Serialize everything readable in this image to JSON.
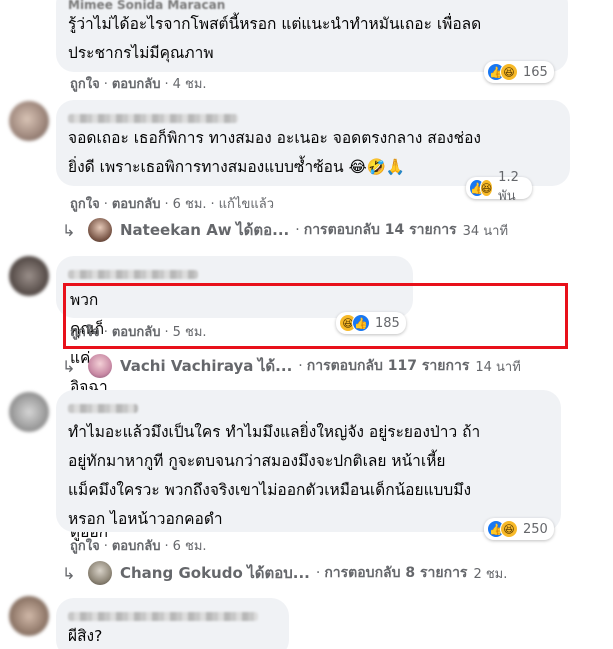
{
  "comments": [
    {
      "author": "Mimee Sonida Maracan",
      "text": "รู้ว่าไม่ได้อะไรจากโพสต์นี้หรอก แต่แนะนำทำหมันเถอะ เพื่อลด\nประชากรไม่มีคุณภาพ",
      "like_label": "ถูกใจ",
      "reply_label": "ตอบกลับ",
      "time": "4 ชม.",
      "reaction_count": "165"
    },
    {
      "author": "",
      "text": "จอดเถอะ เธอก็พิการ ทางสมอง อะเนอะ จอดตรงกลาง สองช่อง\nยิ่งดี เพราะเธอพิการทางสมองแบบซ้ำซ้อน 😂🤣🙏",
      "like_label": "ถูกใจ",
      "reply_label": "ตอบกลับ",
      "time": "6 ชม.",
      "edited_label": "แก้ไขแล้ว",
      "reaction_count": "1.2 พัน",
      "reply_summary": {
        "name": "Nateekan Aw",
        "action": "ได้ตอ...",
        "count_text": "การตอบกลับ 14 รายการ",
        "time": "34 นาที"
      }
    },
    {
      "author": "",
      "text": "พวกคุณก็แค่อิจฉาคนขับ Benz แหละ ดูออก",
      "like_label": "ถูกใจ",
      "reply_label": "ตอบกลับ",
      "time": "5 ชม.",
      "reaction_count": "185",
      "reply_summary": {
        "name": "Vachi Vachiraya",
        "action": "ได้...",
        "count_text": "การตอบกลับ 117 รายการ",
        "time": "14 นาที"
      }
    },
    {
      "author": "",
      "text": "ทำไมอะแล้วมึงเป็นใคร ทำไมมึงแลยิ่งใหญ่จัง อยู่ระยองป่าว ถ้า\nอยู่ทักมาหากูที กูจะตบจนกว่าสมองมึงจะปกติเลย หน้าเหี้ย\nแม็คมึงใครวะ พวกถึงจริงเขาไม่ออกตัวเหมือนเด็กน้อยแบบมึง\nหรอก ไอหน้าวอกคอดำ",
      "like_label": "ถูกใจ",
      "reply_label": "ตอบกลับ",
      "time": "6 ชม.",
      "reaction_count": "250",
      "reply_summary": {
        "name": "Chang Gokudo",
        "action": "ได้ตอบ...",
        "count_text": "การตอบกลับ 8 รายการ",
        "time": "2 ชม."
      }
    },
    {
      "author": "",
      "text": "ผีสิง?"
    }
  ],
  "icons": {
    "reply_arrow": "reply-arrow-icon",
    "like": "like-icon",
    "haha": "haha-icon"
  },
  "colors": {
    "bubble": "#f0f2f5",
    "like_blue": "#1877f2",
    "haha_yellow": "#f7b928",
    "highlight_red": "#e8101a"
  }
}
